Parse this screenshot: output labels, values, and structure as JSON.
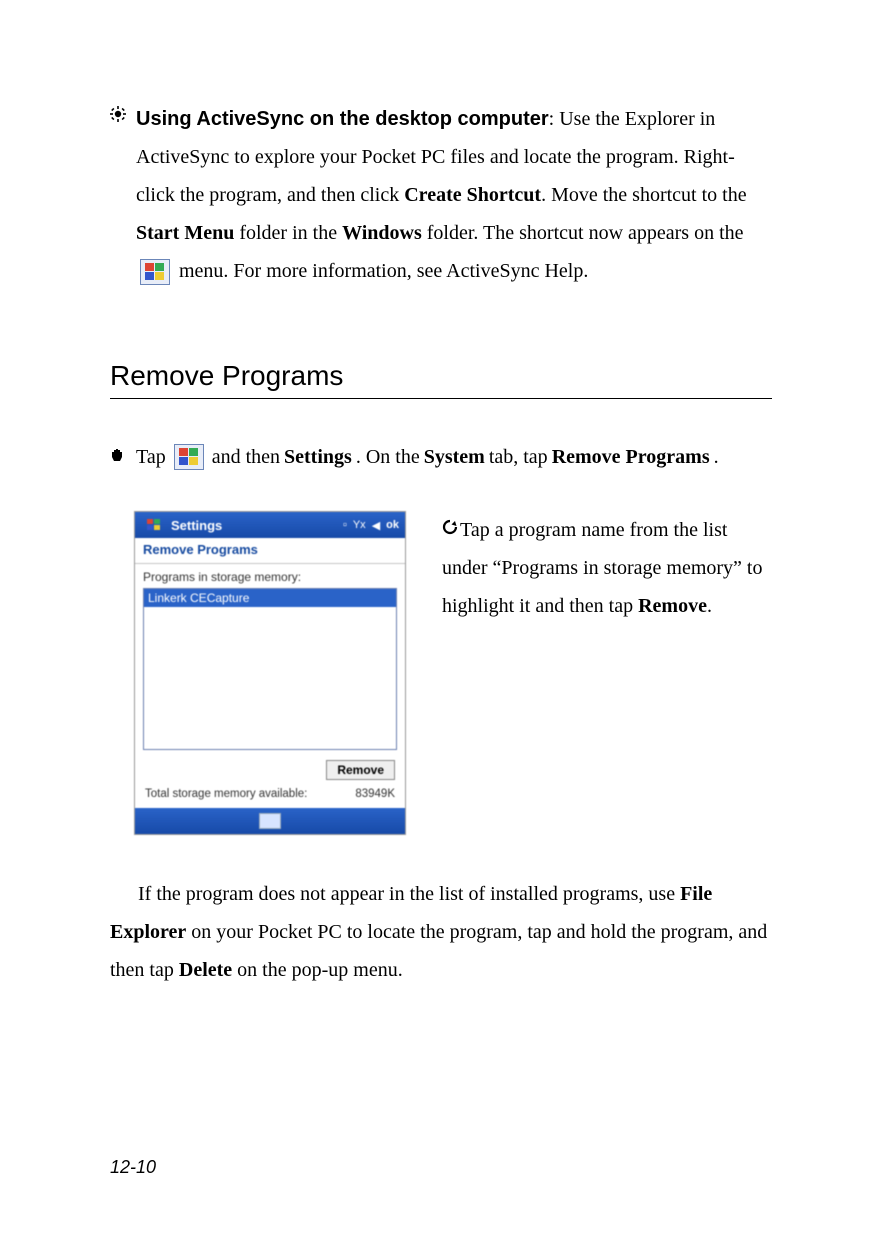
{
  "section1": {
    "bullet_title": "Using ActiveSync on the desktop computer",
    "text_a": ": Use the Explorer in ActiveSync to explore your Pocket PC files and locate the program. Right-click the program, and then click ",
    "bold_a": "Create Shortcut",
    "text_b": ". Move the shortcut to the ",
    "bold_b": "Start Menu",
    "text_c": " folder in the ",
    "bold_c": "Windows",
    "text_d": " folder. The shortcut now appears on the ",
    "text_e": " menu. For more information, see ActiveSync Help."
  },
  "heading": "Remove Programs",
  "tapline": {
    "pre": " Tap ",
    "mid": " and then ",
    "b1": "Settings",
    "t2": ". On the ",
    "b2": "System",
    "t3": " tab, tap ",
    "b3": "Remove Programs",
    "end": "."
  },
  "pocket": {
    "title": "Settings",
    "status_ok": "ok",
    "subtitle": "Remove Programs",
    "sublabel": "Programs in storage memory:",
    "selected": "Linkerk CECapture",
    "remove_btn": "Remove",
    "avail_label": "Total storage memory available:",
    "avail_val": "83949K"
  },
  "side": {
    "text_a": "Tap a program name from the list under “Programs in storage memory” to highlight it and then tap ",
    "bold_a": "Remove",
    "end": "."
  },
  "final": {
    "t1": "If the program does not appear in the list of installed programs, use ",
    "b1": "File Explorer",
    "t2": " on your Pocket PC to locate the program, tap and hold the program, and then tap ",
    "b2": "Delete",
    "t3": " on the pop-up menu."
  },
  "pagenum": "12-10"
}
